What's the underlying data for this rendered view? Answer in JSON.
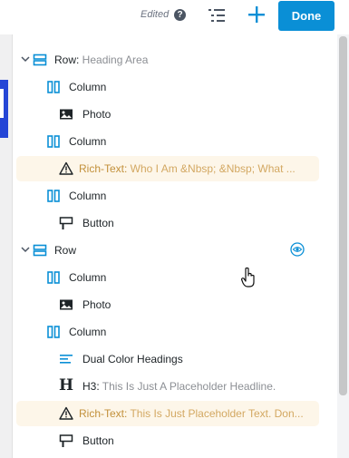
{
  "toolbar": {
    "edited_label": "Edited",
    "help_icon": "?",
    "done_label": "Done"
  },
  "colors": {
    "accent": "#0a8fd6",
    "highlight_bg": "#fdf6e9",
    "warning": "#c2903a"
  },
  "tree": [
    {
      "icon": "row-icon",
      "label": "Row:",
      "sub": " Heading Area"
    },
    {
      "icon": "column-icon",
      "label": "Column",
      "sub": ""
    },
    {
      "icon": "photo-icon",
      "label": "Photo",
      "sub": ""
    },
    {
      "icon": "column-icon",
      "label": "Column",
      "sub": ""
    },
    {
      "icon": "warning-icon",
      "label": "Rich-Text:",
      "sub": " Who I Am &Nbsp; &Nbsp; What ..."
    },
    {
      "icon": "column-icon",
      "label": "Column",
      "sub": ""
    },
    {
      "icon": "button-icon",
      "label": "Button",
      "sub": ""
    },
    {
      "icon": "row-icon",
      "label": "Row",
      "sub": ""
    },
    {
      "icon": "column-icon",
      "label": "Column",
      "sub": ""
    },
    {
      "icon": "photo-icon",
      "label": "Photo",
      "sub": ""
    },
    {
      "icon": "column-icon",
      "label": "Column",
      "sub": ""
    },
    {
      "icon": "dual-color-headings-icon",
      "label": "Dual Color Headings",
      "sub": ""
    },
    {
      "icon": "heading-icon",
      "label": "H3:",
      "sub": " This Is Just A Placeholder Headline."
    },
    {
      "icon": "warning-icon",
      "label": "Rich-Text:",
      "sub": " This Is Just Placeholder Text. Don..."
    },
    {
      "icon": "button-icon",
      "label": "Button",
      "sub": ""
    }
  ]
}
